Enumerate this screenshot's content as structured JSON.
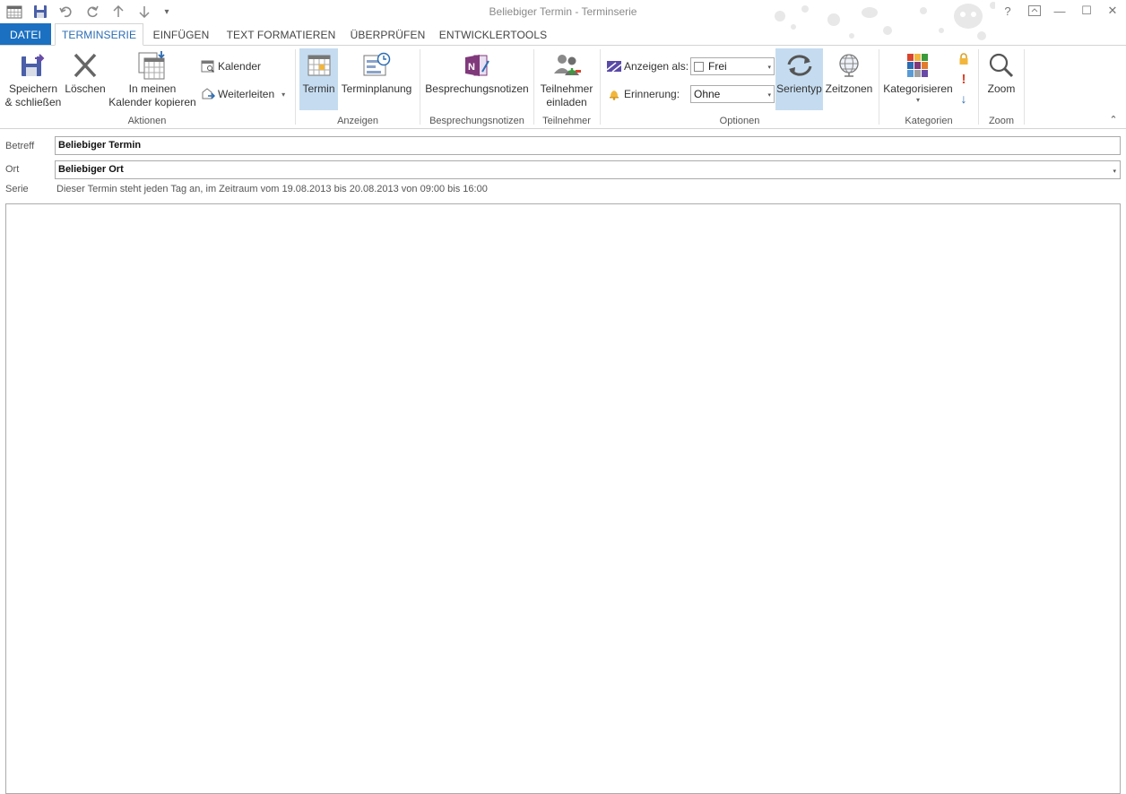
{
  "window": {
    "title": "Beliebiger Termin - Terminserie",
    "help": "?",
    "min": "—",
    "max": "☐",
    "close": "✕"
  },
  "qat": {
    "customize": "▾"
  },
  "tabs": [
    {
      "label": "DATEI"
    },
    {
      "label": "TERMINSERIE"
    },
    {
      "label": "EINFÜGEN"
    },
    {
      "label": "TEXT FORMATIEREN"
    },
    {
      "label": "ÜBERPRÜFEN"
    },
    {
      "label": "ENTWICKLERTOOLS"
    }
  ],
  "ribbon": {
    "aktionen": {
      "label": "Aktionen",
      "save_line1": "Speichern",
      "save_line2": "& schließen",
      "delete": "Löschen",
      "copy_line1": "In meinen",
      "copy_line2": "Kalender kopieren",
      "calendar": "Kalender",
      "forward": "Weiterleiten",
      "forward_arrow": "▾"
    },
    "anzeigen": {
      "label": "Anzeigen",
      "termin": "Termin",
      "terminplanung": "Terminplanung"
    },
    "notizen": {
      "label": "Besprechungsnotizen",
      "button": "Besprechungsnotizen"
    },
    "teilnehmer": {
      "label": "Teilnehmer",
      "invite_line1": "Teilnehmer",
      "invite_line2": "einladen"
    },
    "optionen": {
      "label": "Optionen",
      "show_as_label": "Anzeigen als:",
      "show_as_value": "Frei",
      "reminder_label": "Erinnerung:",
      "reminder_value": "Ohne",
      "dd_arrow": "▾",
      "serientyp": "Serientyp",
      "zeitzonen": "Zeitzonen"
    },
    "kategorien": {
      "label": "Kategorien",
      "categorize": "Kategorisieren",
      "categorize_arrow": "▾",
      "high_importance": "!",
      "low_importance": "↓"
    },
    "zoom": {
      "label": "Zoom",
      "button": "Zoom"
    },
    "collapse": "⌃"
  },
  "form": {
    "subject_label": "Betreff",
    "subject_value": "Beliebiger Termin",
    "location_label": "Ort",
    "location_value": "Beliebiger Ort",
    "location_arrow": "▾",
    "series_label": "Serie",
    "series_text": "Dieser Termin steht jeden Tag an, im Zeitraum vom 19.08.2013 bis 20.08.2013 von 09:00 bis 16:00"
  },
  "colors": {
    "accent": "#1b70c1",
    "selected": "#c5dcf0",
    "importance_high": "#d9442c",
    "importance_low": "#2b6cb3"
  }
}
